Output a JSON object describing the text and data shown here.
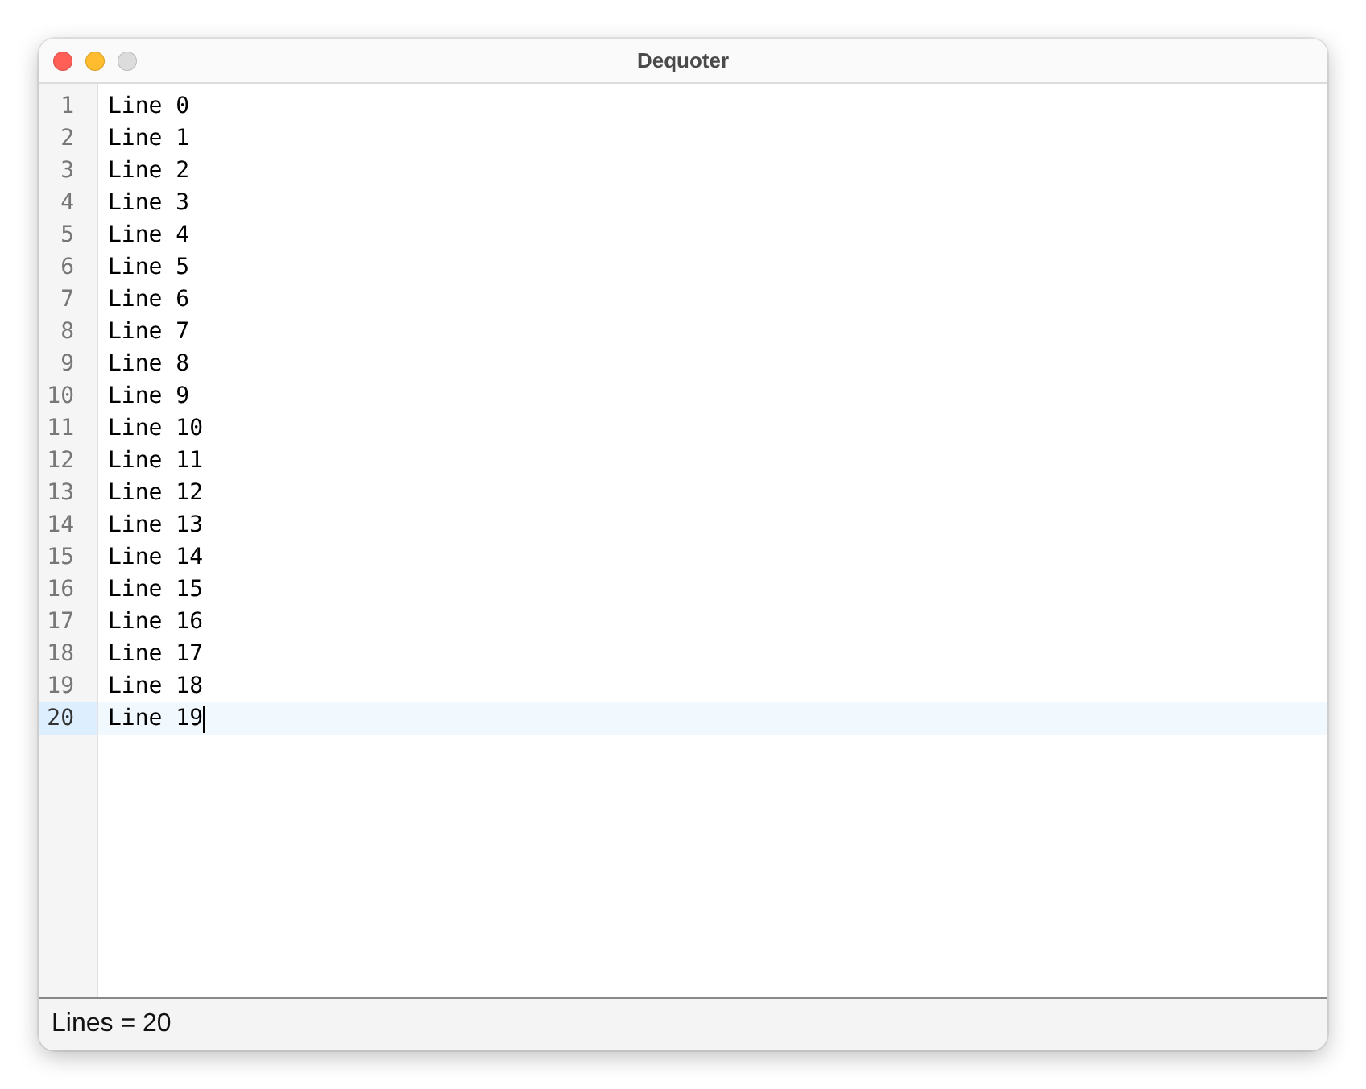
{
  "window": {
    "title": "Dequoter"
  },
  "editor": {
    "lines": [
      {
        "number": "1",
        "text": "Line 0",
        "current": false
      },
      {
        "number": "2",
        "text": "Line 1",
        "current": false
      },
      {
        "number": "3",
        "text": "Line 2",
        "current": false
      },
      {
        "number": "4",
        "text": "Line 3",
        "current": false
      },
      {
        "number": "5",
        "text": "Line 4",
        "current": false
      },
      {
        "number": "6",
        "text": "Line 5",
        "current": false
      },
      {
        "number": "7",
        "text": "Line 6",
        "current": false
      },
      {
        "number": "8",
        "text": "Line 7",
        "current": false
      },
      {
        "number": "9",
        "text": "Line 8",
        "current": false
      },
      {
        "number": "10",
        "text": "Line 9",
        "current": false
      },
      {
        "number": "11",
        "text": "Line 10",
        "current": false
      },
      {
        "number": "12",
        "text": "Line 11",
        "current": false
      },
      {
        "number": "13",
        "text": "Line 12",
        "current": false
      },
      {
        "number": "14",
        "text": "Line 13",
        "current": false
      },
      {
        "number": "15",
        "text": "Line 14",
        "current": false
      },
      {
        "number": "16",
        "text": "Line 15",
        "current": false
      },
      {
        "number": "17",
        "text": "Line 16",
        "current": false
      },
      {
        "number": "18",
        "text": "Line 17",
        "current": false
      },
      {
        "number": "19",
        "text": "Line 18",
        "current": false
      },
      {
        "number": "20",
        "text": "Line 19",
        "current": true
      }
    ]
  },
  "status_bar": {
    "text": "Lines = 20"
  }
}
